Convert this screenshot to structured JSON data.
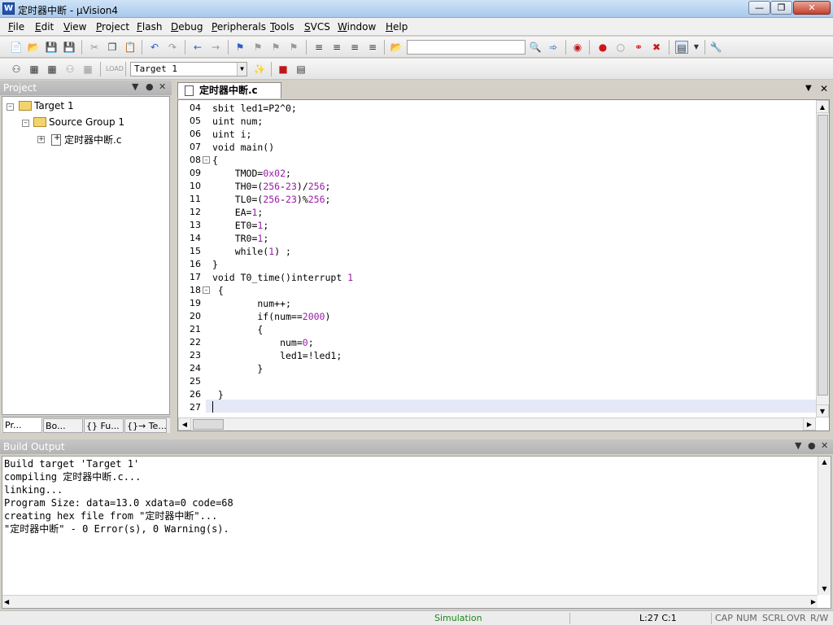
{
  "window": {
    "title": "定时器中断 - µVision4",
    "app_icon": "W"
  },
  "menu": [
    "File",
    "Edit",
    "View",
    "Project",
    "Flash",
    "Debug",
    "Peripherals",
    "Tools",
    "SVCS",
    "Window",
    "Help"
  ],
  "toolbar": {
    "target_select": "Target 1",
    "find_combo": ""
  },
  "project": {
    "title": "Project",
    "tree": {
      "root": "Target 1",
      "group": "Source Group 1",
      "file": "定时器中断.c"
    },
    "tabs": [
      "Pr...",
      "Bo...",
      "{} Fu...",
      "{}→ Te..."
    ]
  },
  "editor": {
    "tab": "定时器中断.c",
    "lines": [
      {
        "n": "04",
        "code": "sbit led1=P2^0;"
      },
      {
        "n": "05",
        "code": "uint num;"
      },
      {
        "n": "06",
        "code": "uint i;"
      },
      {
        "n": "07",
        "code": "void main()"
      },
      {
        "n": "08",
        "code": "{"
      },
      {
        "n": "09",
        "code": "    TMOD=0x02;"
      },
      {
        "n": "10",
        "code": "    TH0=(256-23)/256;"
      },
      {
        "n": "11",
        "code": "    TL0=(256-23)%256;"
      },
      {
        "n": "12",
        "code": "    EA=1;"
      },
      {
        "n": "13",
        "code": "    ET0=1;"
      },
      {
        "n": "14",
        "code": "    TR0=1;"
      },
      {
        "n": "15",
        "code": "    while(1) ;"
      },
      {
        "n": "16",
        "code": "}"
      },
      {
        "n": "17",
        "code": "void T0_time()interrupt 1"
      },
      {
        "n": "18",
        "code": " {"
      },
      {
        "n": "19",
        "code": "        num++;"
      },
      {
        "n": "20",
        "code": "        if(num==2000)"
      },
      {
        "n": "21",
        "code": "        {"
      },
      {
        "n": "22",
        "code": "            num=0;"
      },
      {
        "n": "23",
        "code": "            led1=!led1;"
      },
      {
        "n": "24",
        "code": "        }"
      },
      {
        "n": "25",
        "code": ""
      },
      {
        "n": "26",
        "code": " }"
      },
      {
        "n": "27",
        "code": ""
      }
    ]
  },
  "build": {
    "title": "Build Output",
    "lines": [
      "Build target 'Target 1'",
      "compiling 定时器中断.c...",
      "linking...",
      "Program Size: data=13.0 xdata=0 code=68",
      "creating hex file from \"定时器中断\"...",
      "\"定时器中断\" - 0 Error(s), 0 Warning(s)."
    ]
  },
  "status": {
    "mode": "Simulation",
    "position": "L:27 C:1",
    "caps": "CAP",
    "num": "NUM",
    "scrl": "SCRL",
    "ovr": "OVR",
    "rw": "R/W"
  },
  "colors": {
    "number_literal": "#9b1aa8",
    "mode_text": "#1a8a1a"
  }
}
